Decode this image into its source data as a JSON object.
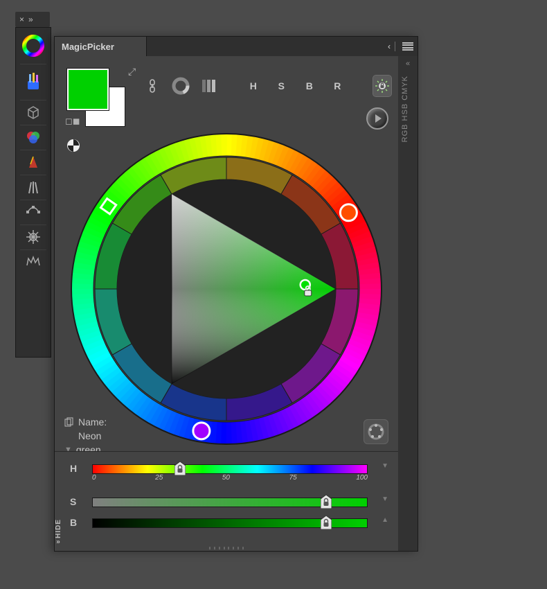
{
  "tab_strip": {
    "close": "×",
    "expand": "»"
  },
  "panel": {
    "title": "MagicPicker",
    "collapse_chevrons": "‹‹",
    "right_rail_collapse": "«",
    "right_rail_label": "RGB HSB CMYK"
  },
  "left_dock": [
    {
      "name": "magicpicker-ring-icon",
      "main": true
    },
    {
      "name": "brush-cup-icon",
      "main": true
    },
    {
      "name": "box-3d-icon"
    },
    {
      "name": "rgb-venn-icon"
    },
    {
      "name": "metronome-icon"
    },
    {
      "name": "brushes-icon"
    },
    {
      "name": "pen-nodes-icon"
    },
    {
      "name": "ship-wheel-icon"
    },
    {
      "name": "crown-icon"
    }
  ],
  "swatches": {
    "foreground": "#00D000",
    "background": "#FFFFFF"
  },
  "toolbar": {
    "link_icon": "link-icon",
    "ring_icon": "ring-wheel-icon",
    "bars_icon": "gradient-bars-icon",
    "H": "H",
    "S": "S",
    "B": "B",
    "R": "R",
    "hue_lock_icon": "hue-lock-icon"
  },
  "wheel": {
    "hue_marker_deg": 127,
    "scheme_markers": [
      {
        "deg": 5,
        "color": "#ff4d00",
        "name": "scheme-marker-orange"
      },
      {
        "deg": 255,
        "color": "#a000ff",
        "name": "scheme-marker-violet"
      }
    ],
    "triangle_point": {
      "r": 0.88,
      "theta_frac": 0.99
    }
  },
  "color_name": {
    "label": "Name:",
    "value1": "Neon",
    "value2": "green"
  },
  "sliders": {
    "H": {
      "label": "H",
      "value_pct": 32
    },
    "S": {
      "label": "S",
      "value_pct": 85
    },
    "B": {
      "label": "B",
      "value_pct": 85
    },
    "ticks": [
      "0",
      "25",
      "50",
      "75",
      "100"
    ],
    "hide_label": "HIDE"
  }
}
